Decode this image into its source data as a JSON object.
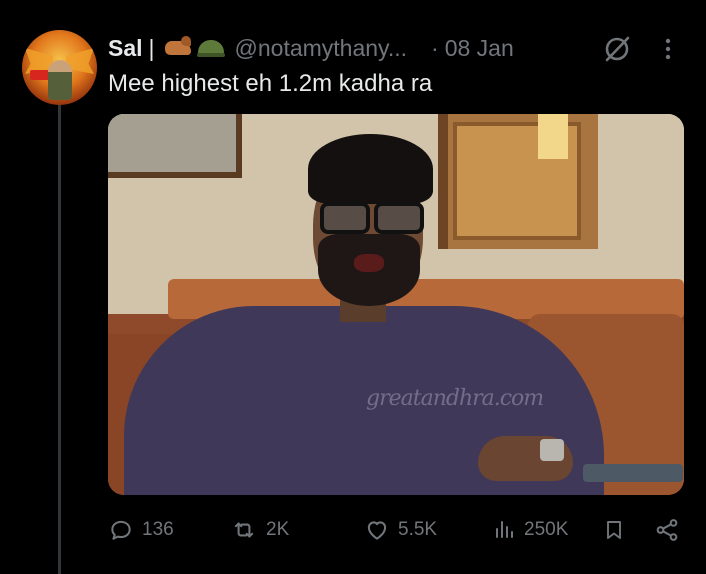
{
  "tweet": {
    "author_name": "Sal",
    "name_separator": "|",
    "handle": "@notamythany...",
    "date_dot": "·",
    "date": "08 Jan",
    "text": "Mee highest eh 1.2m kadha ra",
    "media_watermark": "greatandhra.com",
    "icons": [
      "horse-emoji",
      "helmet-emoji",
      "grok-icon",
      "more-icon"
    ]
  },
  "actions": {
    "replies": "136",
    "retweets": "2K",
    "likes": "5.5K",
    "views": "250K"
  }
}
